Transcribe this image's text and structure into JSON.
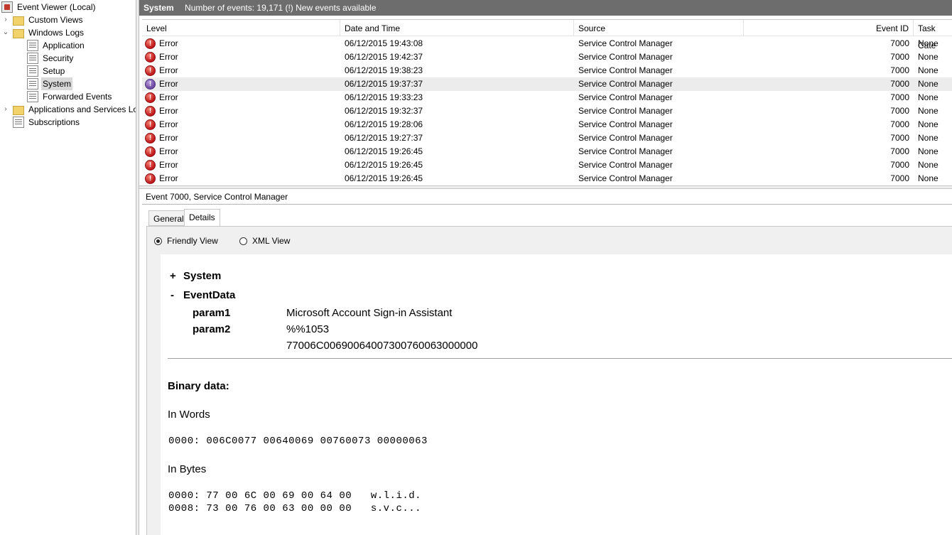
{
  "tree": {
    "root": "Event Viewer (Local)",
    "custom_views": "Custom Views",
    "windows_logs": "Windows Logs",
    "application": "Application",
    "security": "Security",
    "setup": "Setup",
    "system": "System",
    "forwarded": "Forwarded Events",
    "apps_services": "Applications and Services Lo",
    "subscriptions": "Subscriptions"
  },
  "header": {
    "log_name": "System",
    "summary": "Number of events: 19,171 (!) New events available"
  },
  "grid": {
    "columns": [
      "Level",
      "Date and Time",
      "Source",
      "Event ID",
      "Task Cate"
    ],
    "rows": [
      {
        "level": "Error",
        "date": "06/12/2015 19:43:08",
        "source": "Service Control Manager",
        "id": "7000",
        "task": "None"
      },
      {
        "level": "Error",
        "date": "06/12/2015 19:42:37",
        "source": "Service Control Manager",
        "id": "7000",
        "task": "None"
      },
      {
        "level": "Error",
        "date": "06/12/2015 19:38:23",
        "source": "Service Control Manager",
        "id": "7000",
        "task": "None"
      },
      {
        "level": "Error",
        "date": "06/12/2015 19:37:37",
        "source": "Service Control Manager",
        "id": "7000",
        "task": "None"
      },
      {
        "level": "Error",
        "date": "06/12/2015 19:33:23",
        "source": "Service Control Manager",
        "id": "7000",
        "task": "None"
      },
      {
        "level": "Error",
        "date": "06/12/2015 19:32:37",
        "source": "Service Control Manager",
        "id": "7000",
        "task": "None"
      },
      {
        "level": "Error",
        "date": "06/12/2015 19:28:06",
        "source": "Service Control Manager",
        "id": "7000",
        "task": "None"
      },
      {
        "level": "Error",
        "date": "06/12/2015 19:27:37",
        "source": "Service Control Manager",
        "id": "7000",
        "task": "None"
      },
      {
        "level": "Error",
        "date": "06/12/2015 19:26:45",
        "source": "Service Control Manager",
        "id": "7000",
        "task": "None"
      },
      {
        "level": "Error",
        "date": "06/12/2015 19:26:45",
        "source": "Service Control Manager",
        "id": "7000",
        "task": "None"
      },
      {
        "level": "Error",
        "date": "06/12/2015 19:26:45",
        "source": "Service Control Manager",
        "id": "7000",
        "task": "None"
      }
    ]
  },
  "detail": {
    "title": "Event 7000, Service Control Manager",
    "tab_general": "General",
    "tab_details": "Details",
    "radio_friendly": "Friendly View",
    "radio_xml": "XML View",
    "plus": "+",
    "minus": "-",
    "system": "System",
    "eventdata": "EventData",
    "param1_name": "param1",
    "param1_value": "Microsoft Account Sign-in Assistant",
    "param2_name": "param2",
    "param2_value": "%%1053",
    "binary_hex": "77006C00690064007300760063000000",
    "binary_title": "Binary data:",
    "in_words": "In Words",
    "words_line": "0000: 006C0077 00640069 00760073 00000063",
    "in_bytes": "In Bytes",
    "bytes_line1": "0000: 77 00 6C 00 69 00 64 00   w.l.i.d.",
    "bytes_line2": "0008: 73 00 76 00 63 00 00 00   s.v.c..."
  }
}
